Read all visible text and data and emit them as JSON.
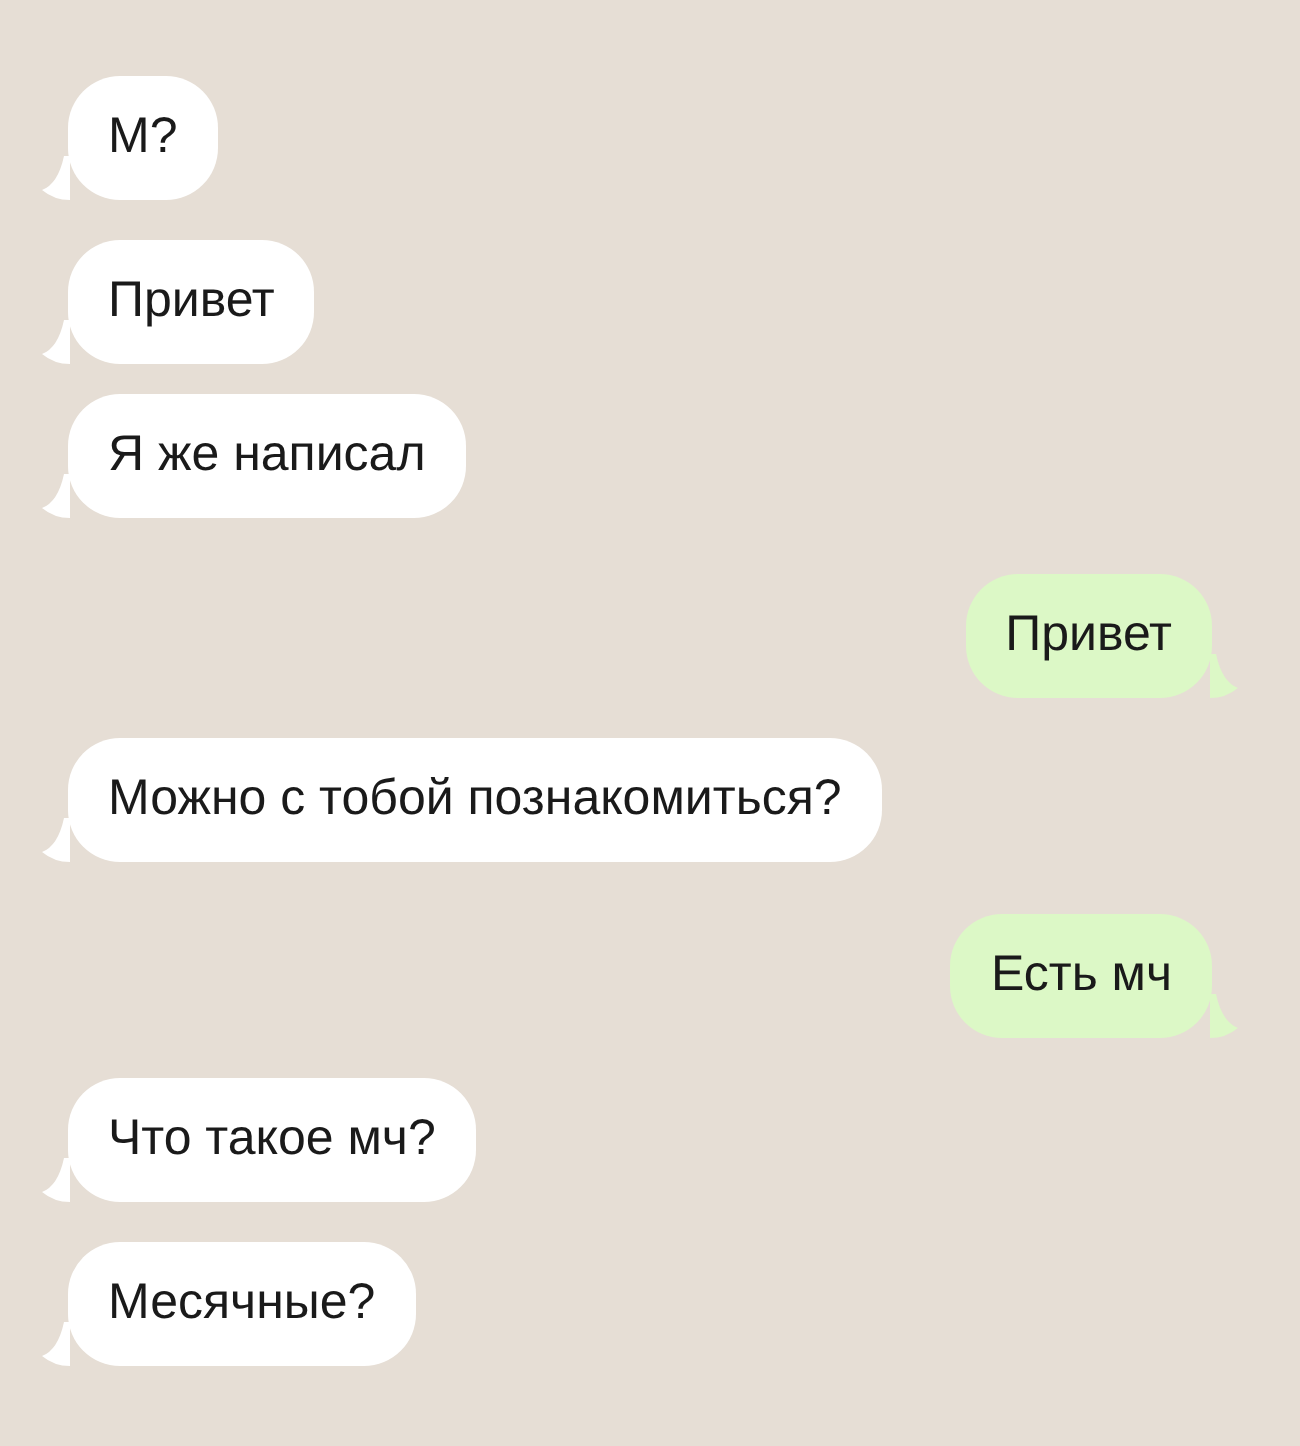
{
  "messages": [
    {
      "text": "М?",
      "kind": "incoming"
    },
    {
      "text": "Привет",
      "kind": "incoming"
    },
    {
      "text": "Я же написал",
      "kind": "incoming"
    },
    {
      "text": "Привет",
      "kind": "outgoing"
    },
    {
      "text": "Можно с тобой познакомиться?",
      "kind": "incoming"
    },
    {
      "text": "Есть мч",
      "kind": "outgoing"
    },
    {
      "text": "Что такое мч?",
      "kind": "incoming"
    },
    {
      "text": "Месячные?",
      "kind": "incoming"
    }
  ]
}
